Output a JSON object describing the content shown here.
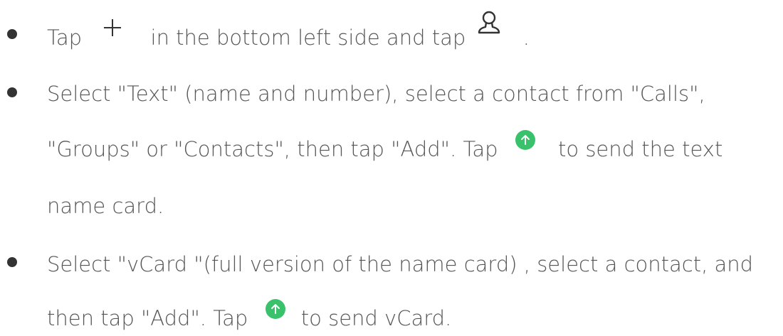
{
  "instructions": {
    "item1": {
      "part1": "Tap",
      "icon1": "plus-icon",
      "part2": "in the bottom left side and tap",
      "icon2": "person-icon",
      "part3": "."
    },
    "item2": {
      "line1": "Select \"Text\" (name and number), select a contact from \"Calls\",",
      "line2_part1": "\"Groups\" or \"Contacts\", then tap \"Add\". Tap",
      "icon": "send-icon",
      "line2_part2": "to send the text",
      "line3": "name card."
    },
    "item3": {
      "line1": "Select \"vCard \"(full version of the name card) , select a contact, and",
      "line2_part1": "then tap \"Add\". Tap",
      "icon": "send-icon",
      "line2_part2": "to send vCard."
    }
  },
  "colors": {
    "text": "#555555",
    "bullet": "#333333",
    "send_icon": "#39c26b"
  }
}
